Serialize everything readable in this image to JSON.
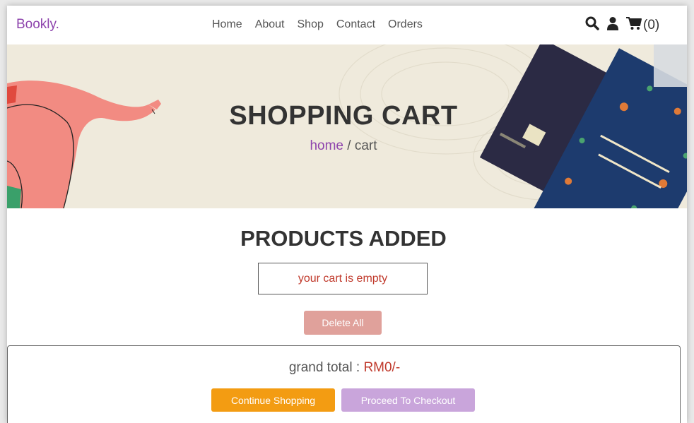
{
  "header": {
    "logo": "Bookly.",
    "nav": [
      "Home",
      "About",
      "Shop",
      "Contact",
      "Orders"
    ],
    "cart_count": "(0)",
    "icons": [
      "search-icon",
      "user-icon",
      "cart-icon"
    ]
  },
  "hero": {
    "title": "SHOPPING CART",
    "crumb_home": "home",
    "crumb_sep": " / ",
    "crumb_current": "cart"
  },
  "products": {
    "title": "PRODUCTS ADDED",
    "empty_message": "your cart is empty",
    "delete_all_label": "Delete All"
  },
  "totals": {
    "grand_label": "grand total : ",
    "grand_value": "RM0/-",
    "continue_label": "Continue Shopping",
    "checkout_label": "Proceed To Checkout"
  },
  "colors": {
    "brand": "#8e44ad",
    "danger": "#c0392b",
    "continue_button": "#f39c12",
    "checkout_button": "#c9a5db",
    "delete_button": "#e0a19b"
  }
}
